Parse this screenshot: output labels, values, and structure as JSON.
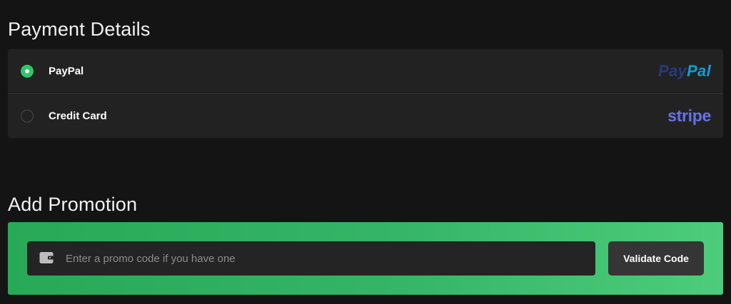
{
  "payment": {
    "title": "Payment Details",
    "methods": [
      {
        "label": "PayPal",
        "selected": true,
        "logo_part1": "Pay",
        "logo_part2": "Pal"
      },
      {
        "label": "Credit Card",
        "selected": false,
        "logo": "stripe"
      }
    ]
  },
  "promotion": {
    "title": "Add Promotion",
    "input_value": "",
    "placeholder": "Enter a promo code if you have one",
    "validate_label": "Validate Code",
    "icon": "wallet-icon"
  },
  "colors": {
    "background": "#141414",
    "card": "#222222",
    "accent_green": "#2ec866",
    "paypal_dark": "#253b80",
    "paypal_light": "#179bd7",
    "stripe": "#6772e5"
  }
}
